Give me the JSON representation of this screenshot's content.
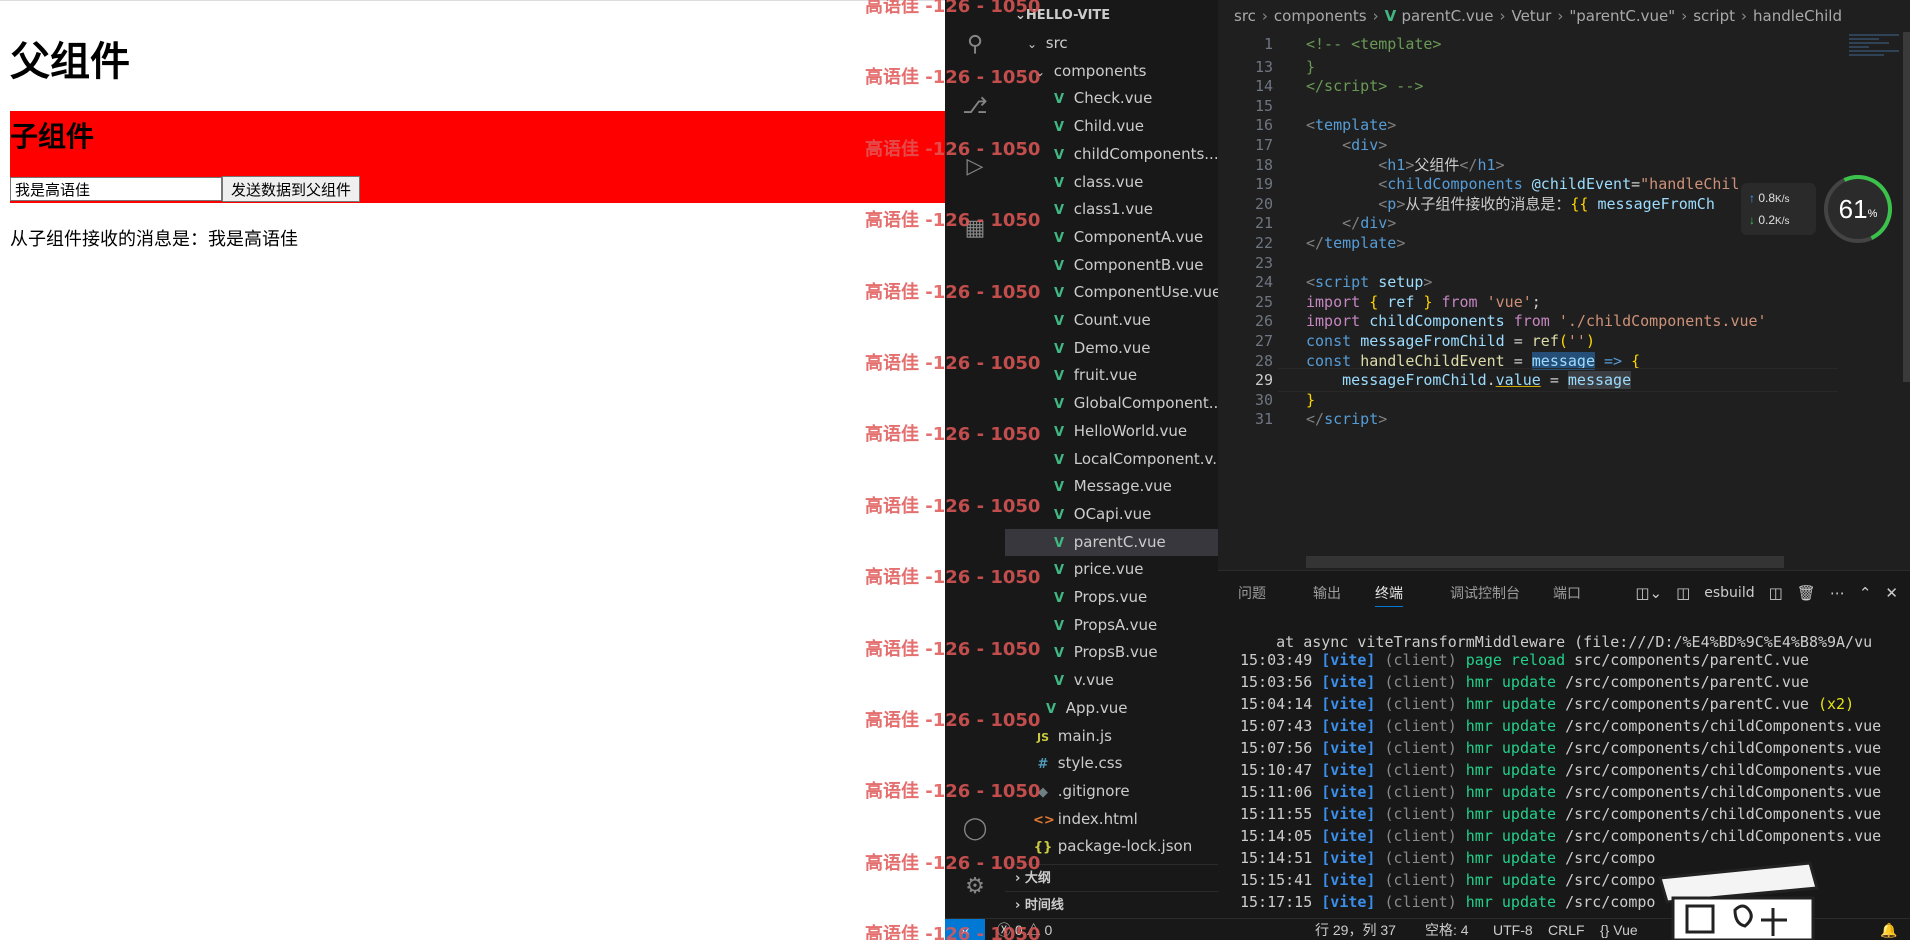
{
  "preview": {
    "h1": "父组件",
    "child_title": "子组件",
    "input_value": "我是高语佳",
    "send_button": "发送数据到父组件",
    "message_label": "从子组件接收的消息是：",
    "message_value": "我是高语佳",
    "watermark": "高语佳 -126 - 1050"
  },
  "explorer": {
    "root": "HELLO-VITE",
    "items": [
      {
        "label": "src",
        "kind": "folder"
      },
      {
        "label": "components",
        "kind": "folder"
      },
      {
        "label": "Check.vue",
        "kind": "vue"
      },
      {
        "label": "Child.vue",
        "kind": "vue"
      },
      {
        "label": "childComponents....",
        "kind": "vue"
      },
      {
        "label": "class.vue",
        "kind": "vue"
      },
      {
        "label": "class1.vue",
        "kind": "vue"
      },
      {
        "label": "ComponentA.vue",
        "kind": "vue"
      },
      {
        "label": "ComponentB.vue",
        "kind": "vue"
      },
      {
        "label": "ComponentUse.vue",
        "kind": "vue"
      },
      {
        "label": "Count.vue",
        "kind": "vue"
      },
      {
        "label": "Demo.vue",
        "kind": "vue"
      },
      {
        "label": "fruit.vue",
        "kind": "vue"
      },
      {
        "label": "GlobalComponent....",
        "kind": "vue"
      },
      {
        "label": "HelloWorld.vue",
        "kind": "vue"
      },
      {
        "label": "LocalComponent.v...",
        "kind": "vue"
      },
      {
        "label": "Message.vue",
        "kind": "vue"
      },
      {
        "label": "OCapi.vue",
        "kind": "vue"
      },
      {
        "label": "parentC.vue",
        "kind": "vue",
        "selected": true
      },
      {
        "label": "price.vue",
        "kind": "vue"
      },
      {
        "label": "Props.vue",
        "kind": "vue"
      },
      {
        "label": "PropsA.vue",
        "kind": "vue"
      },
      {
        "label": "PropsB.vue",
        "kind": "vue"
      },
      {
        "label": "v.vue",
        "kind": "vue"
      },
      {
        "label": "App.vue",
        "kind": "vue"
      },
      {
        "label": "main.js",
        "kind": "js"
      },
      {
        "label": "style.css",
        "kind": "css"
      },
      {
        "label": ".gitignore",
        "kind": "git"
      },
      {
        "label": "index.html",
        "kind": "html"
      },
      {
        "label": "package-lock.json",
        "kind": "json"
      }
    ],
    "outline": "大纲",
    "timeline": "时间线"
  },
  "breadcrumbs": [
    "src",
    "components",
    "parentC.vue",
    "Vetur",
    "\"parentC.vue\"",
    "script",
    "handleChild"
  ],
  "code": {
    "current_line": 29,
    "lines": [
      {
        "n": "1",
        "html": "<span class='tk-cmt'>&lt;!-- &lt;template&gt;</span>"
      },
      {
        "n": "13",
        "html": "<span class='tk-cmt'>}</span>"
      },
      {
        "n": "14",
        "html": "<span class='tk-cmt'>&lt;/script&gt; --&gt;</span>"
      },
      {
        "n": "15",
        "html": ""
      },
      {
        "n": "16",
        "html": "<span class='tk-pun'>&lt;</span><span class='tk-tag'>template</span><span class='tk-pun'>&gt;</span>"
      },
      {
        "n": "17",
        "html": "    <span class='tk-pun'>&lt;</span><span class='tk-tag'>div</span><span class='tk-pun'>&gt;</span>"
      },
      {
        "n": "18",
        "html": "        <span class='tk-pun'>&lt;</span><span class='tk-tag'>h1</span><span class='tk-pun'>&gt;</span>父组件<span class='tk-pun'>&lt;/</span><span class='tk-tag'>h1</span><span class='tk-pun'>&gt;</span>"
      },
      {
        "n": "19",
        "html": "        <span class='tk-pun'>&lt;</span><span class='tk-tag'>childComponents</span> <span class='tk-attr'>@childEvent</span>=<span class='tk-str'>\"handleChil</span>"
      },
      {
        "n": "20",
        "html": "        <span class='tk-pun'>&lt;</span><span class='tk-tag'>p</span><span class='tk-pun'>&gt;</span>从子组件接收的消息是：<span class='tk-mus'>{{</span> <span class='tk-var'>messageFromCh</span>"
      },
      {
        "n": "21",
        "html": "    <span class='tk-pun'>&lt;/</span><span class='tk-tag'>div</span><span class='tk-pun'>&gt;</span>"
      },
      {
        "n": "22",
        "html": "<span class='tk-pun'>&lt;/</span><span class='tk-tag'>template</span><span class='tk-pun'>&gt;</span>"
      },
      {
        "n": "23",
        "html": ""
      },
      {
        "n": "24",
        "html": "<span class='tk-pun'>&lt;</span><span class='tk-tag'>script</span> <span class='tk-attr'>setup</span><span class='tk-pun'>&gt;</span>"
      },
      {
        "n": "25",
        "html": "<span class='tk-kw'>import</span> <span class='tk-brk'>{</span> <span class='tk-var'>ref</span> <span class='tk-brk'>}</span> <span class='tk-kw'>from</span> <span class='tk-str'>'vue'</span>;"
      },
      {
        "n": "26",
        "html": "<span class='tk-kw'>import</span> <span class='tk-var'>childComponents</span> <span class='tk-kw'>from</span> <span class='tk-str'>'./childComponents.vue'</span>"
      },
      {
        "n": "27",
        "html": "<span class='tk-kw2'>const</span> <span class='tk-var'>messageFromChild</span> = <span class='tk-fn'>ref</span><span class='tk-brk'>(</span><span class='tk-str'>''</span><span class='tk-brk'>)</span>"
      },
      {
        "n": "28",
        "html": "<span class='tk-kw2'>const</span> <span class='tk-fn'>handleChildEvent</span> = <span class='tk-hl'>message</span> <span class='tk-kw2'>=&gt;</span> <span class='tk-brk'>{</span>"
      },
      {
        "n": "29",
        "html": "    <span class='tk-var'>messageFromChild</span>.<span class='tk-var' style='text-decoration:underline;text-decoration-color:#cca700'>value</span> = <span class='tk-hl2'>message</span>"
      },
      {
        "n": "30",
        "html": "<span class='tk-brk'>}</span>"
      },
      {
        "n": "31",
        "html": "<span class='tk-pun'>&lt;/</span><span class='tk-tag'>script</span><span class='tk-pun'>&gt;</span>"
      }
    ]
  },
  "speed": {
    "up": "0.8",
    "down": "0.2",
    "unit": "K/s",
    "cpu": "61",
    "pct": "%"
  },
  "panel": {
    "tabs": [
      "问题",
      "输出",
      "终端",
      "调试控制台",
      "端口"
    ],
    "active_tab": 2,
    "terminal_name": "esbuild",
    "first_line": "    at async viteTransformMiddleware (file:///D:/%E4%BD%9C%E4%B8%9A/vu",
    "log": [
      {
        "time": "15:03:49",
        "action": "page reload",
        "path": "src/components/parentC.vue",
        "extra": ""
      },
      {
        "time": "15:03:56",
        "action": "hmr update",
        "path": "/src/components/parentC.vue",
        "extra": ""
      },
      {
        "time": "15:04:14",
        "action": "hmr update",
        "path": "/src/components/parentC.vue",
        "extra": "(x2)"
      },
      {
        "time": "15:07:43",
        "action": "hmr update",
        "path": "/src/components/childComponents.vue",
        "extra": ""
      },
      {
        "time": "15:07:56",
        "action": "hmr update",
        "path": "/src/components/childComponents.vue",
        "extra": ""
      },
      {
        "time": "15:10:47",
        "action": "hmr update",
        "path": "/src/components/childComponents.vue",
        "extra": ""
      },
      {
        "time": "15:11:06",
        "action": "hmr update",
        "path": "/src/components/childComponents.vue",
        "extra": ""
      },
      {
        "time": "15:11:55",
        "action": "hmr update",
        "path": "/src/components/childComponents.vue",
        "extra": ""
      },
      {
        "time": "15:14:05",
        "action": "hmr update",
        "path": "/src/components/childComponents.vue",
        "extra": ""
      },
      {
        "time": "15:14:51",
        "action": "hmr update",
        "path": "/src/compo",
        "extra": ""
      },
      {
        "time": "15:15:41",
        "action": "hmr update",
        "path": "/src/compo",
        "extra": ""
      },
      {
        "time": "15:17:15",
        "action": "hmr update",
        "path": "/src/compo",
        "extra": ""
      }
    ],
    "vite_tag": "[vite]",
    "client_tag": "(client)"
  },
  "status": {
    "errors": "0",
    "warnings": "0",
    "position": "行 29，列 37",
    "spaces": "空格: 4",
    "encoding": "UTF-8",
    "eol": "CRLF",
    "language": "Vue"
  },
  "colors": {
    "accent": "#0078d4",
    "vue": "#41b883",
    "red_box": "#ff0000",
    "watermark": "#e05757"
  }
}
